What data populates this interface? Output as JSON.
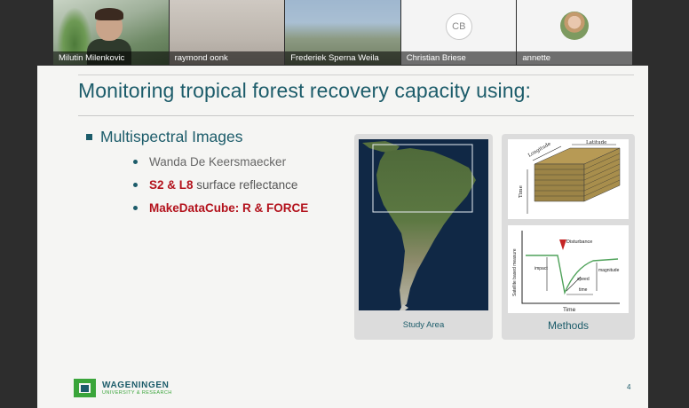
{
  "participants": [
    {
      "name": "Milutin Milenkovic",
      "type": "video"
    },
    {
      "name": "raymond oonk",
      "type": "video"
    },
    {
      "name": "Frederiek Sperna Weila",
      "type": "video"
    },
    {
      "name": "Christian Briese",
      "type": "initials",
      "initials": "CB"
    },
    {
      "name": "annette",
      "type": "avatar"
    }
  ],
  "slide": {
    "title": "Monitoring tropical forest recovery capacity using:",
    "bullet": "Multispectral Images",
    "sub_items": [
      {
        "plain": "Wanda De Keersmaecker"
      },
      {
        "bold": "S2 & L8",
        "plain": " surface reflectance"
      },
      {
        "bold": "MakeDataCube: R & FORCE"
      }
    ],
    "study_area_caption": "Study Area",
    "methods_caption": "Methods",
    "cube_labels": {
      "latitude": "Latitude",
      "longitude": "Longitude",
      "time": "Time"
    },
    "curve_labels": {
      "disturbance": "Disturbance",
      "impact": "impact",
      "magnitude": "magnitude",
      "speed": "speed",
      "time_inner": "time",
      "ylabel": "Satellite based measure",
      "xlabel": "Time"
    },
    "logo": {
      "line1": "WAGENINGEN",
      "line2": "UNIVERSITY & RESEARCH"
    },
    "page_number": "4"
  },
  "colors": {
    "accent": "#1c5c6a",
    "red": "#b3121c",
    "logo_green": "#3aa53a"
  }
}
